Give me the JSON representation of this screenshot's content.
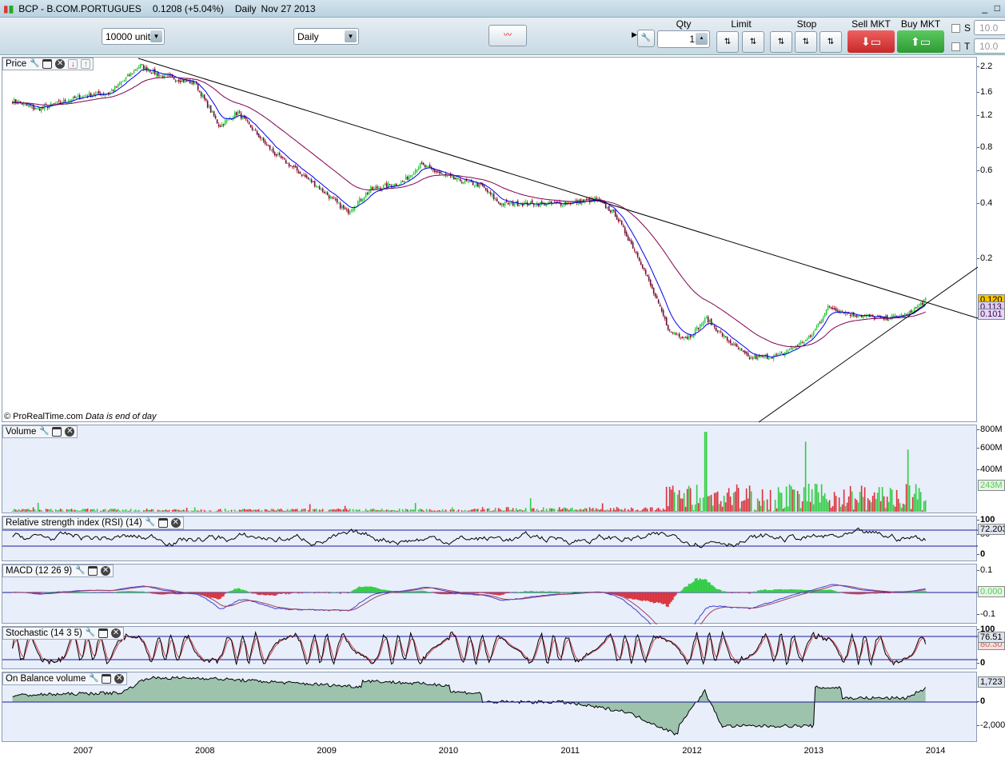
{
  "title": {
    "symbol": "BCP - B.COM.PORTUGUES",
    "price": "0.1208 (+5.04%)",
    "period": "Daily",
    "date": "Nov 27 2013"
  },
  "toolbar": {
    "units": "10000 units",
    "interval": "Daily",
    "qty_label": "Qty",
    "qty": "1",
    "limit_label": "Limit",
    "stop_label": "Stop",
    "sell_label": "Sell MKT",
    "buy_label": "Buy MKT",
    "s_label": "S",
    "t_label": "T",
    "s_value": "10.0",
    "t_value": "10.0"
  },
  "panels": {
    "price": {
      "title": "Price",
      "copyright": "© ProRealTime.com",
      "note": "Data is end of day",
      "ticks": [
        "2.2",
        "1.6",
        "1.2",
        "0.8",
        "0.6",
        "0.4",
        "0.2"
      ],
      "last": "0.120",
      "ma1": "0.113",
      "ma2": "0.101"
    },
    "volume": {
      "title": "Volume",
      "ticks": [
        "800M",
        "600M",
        "400M"
      ],
      "last": "243M"
    },
    "rsi": {
      "title": "Relative strength index (RSI) (14)",
      "ticks": [
        "100",
        "50",
        "0"
      ],
      "last": "72.203"
    },
    "macd": {
      "title": "MACD (12 26 9)",
      "ticks": [
        "0.1",
        "-0.1"
      ],
      "last": "0.000"
    },
    "stoch": {
      "title": "Stochastic (14 3 5)",
      "ticks": [
        "100",
        "0"
      ],
      "last": "76.51",
      "last2": "80.30"
    },
    "obv": {
      "title": "On Balance volume",
      "ticks": [
        "0",
        "-2,000"
      ],
      "last": "1,723"
    }
  },
  "xaxis": [
    "2007",
    "2008",
    "2009",
    "2010",
    "2011",
    "2012",
    "2013",
    "2014"
  ],
  "colors": {
    "up": "#2ecc40",
    "down": "#d9303a",
    "ma_fast": "#0000ee",
    "ma_slow": "#800050",
    "panel_bg": "#e8eefa"
  },
  "chart_data": {
    "type": "candlestick",
    "scale": "log",
    "x": [
      "2006.4",
      "2006.6",
      "2007.0",
      "2007.2",
      "2007.45",
      "2007.6",
      "2007.9",
      "2008.1",
      "2008.25",
      "2008.55",
      "2008.9",
      "2009.15",
      "2009.35",
      "2009.6",
      "2009.75",
      "2010.0",
      "2010.25",
      "2010.4",
      "2010.9",
      "2011.2",
      "2011.35",
      "2011.55",
      "2011.8",
      "2011.95",
      "2012.1",
      "2012.25",
      "2012.45",
      "2012.7",
      "2012.95",
      "2013.1",
      "2013.3",
      "2013.55",
      "2013.75",
      "2013.9"
    ],
    "close": [
      1.45,
      1.3,
      1.55,
      1.6,
      2.25,
      2.0,
      1.8,
      1.05,
      1.25,
      0.75,
      0.5,
      0.36,
      0.48,
      0.52,
      0.65,
      0.55,
      0.5,
      0.4,
      0.4,
      0.42,
      0.35,
      0.2,
      0.08,
      0.075,
      0.095,
      0.075,
      0.058,
      0.06,
      0.075,
      0.11,
      0.1,
      0.095,
      0.1,
      0.12
    ],
    "series": [
      "Price",
      "MA fast",
      "MA slow",
      "Volume",
      "RSI",
      "MACD",
      "Stochastic",
      "OBV"
    ]
  }
}
